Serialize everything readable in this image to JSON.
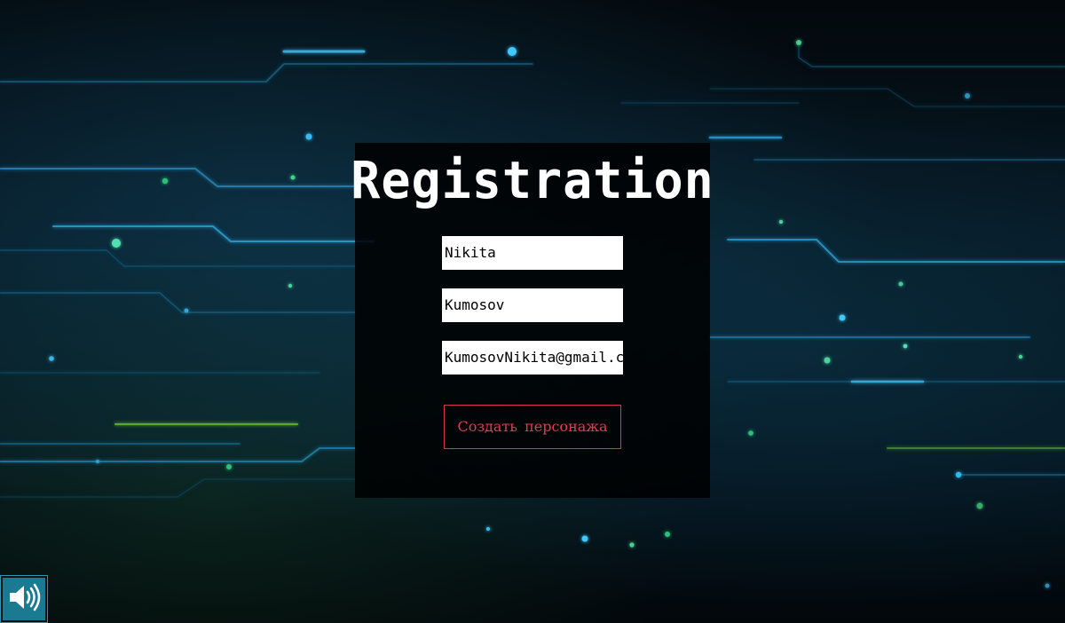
{
  "title": "Registration",
  "form": {
    "first_name": "Nikita",
    "last_name": "Kumosov",
    "email": "KumosovNikita@gmail.com"
  },
  "create_button": "Создать  персонажа",
  "icons": {
    "sound": "speaker-volume-icon"
  },
  "colors": {
    "panel": "#000000",
    "accent": "#e23b55",
    "sound_button": "#1a7a91"
  }
}
